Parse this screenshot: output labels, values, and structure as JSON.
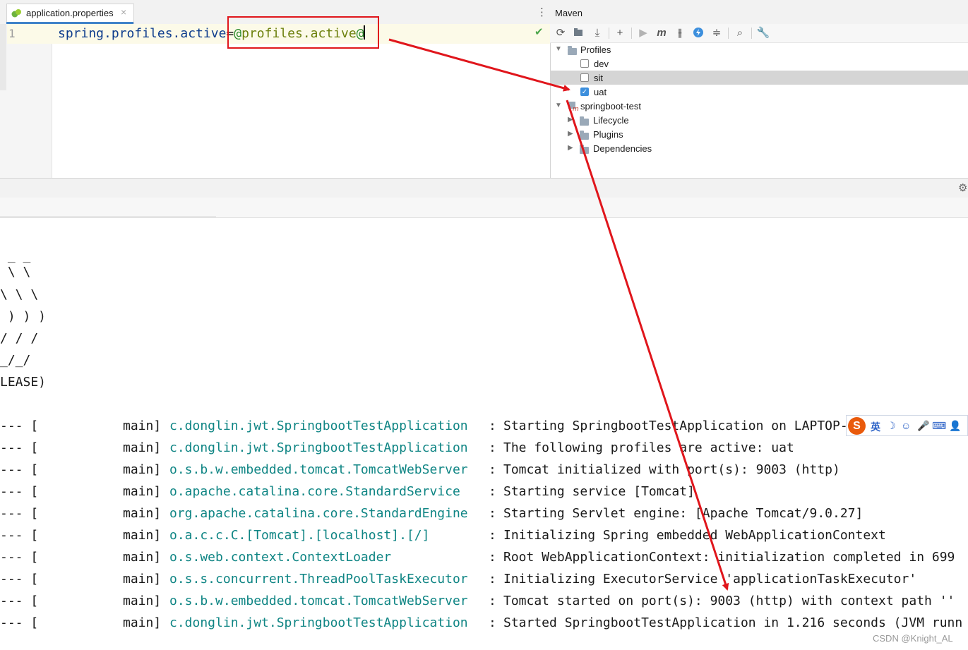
{
  "editor": {
    "tab_label": "application.properties",
    "tab_close": "×",
    "more_icon": "⋮",
    "line_number": "1",
    "code": {
      "key": "spring.profiles.active",
      "equals": "=",
      "at_open": "@",
      "value": "profiles.active",
      "at_close": "@"
    },
    "inspection_icon": "✔"
  },
  "maven": {
    "title": "Maven",
    "toolbar": [
      "reload-icon",
      "reimport-folder-icon",
      "download-icon",
      "add-icon",
      "run-icon",
      "maven-goal-icon",
      "toggle-offline-icon",
      "lightning-icon",
      "collapse-icon",
      "show-dependencies-icon",
      "settings-wrench-icon"
    ],
    "profiles_label": "Profiles",
    "profiles": [
      {
        "name": "dev",
        "checked": false
      },
      {
        "name": "sit",
        "checked": false
      },
      {
        "name": "uat",
        "checked": true
      }
    ],
    "project": "springboot-test",
    "children": [
      "Lifecycle",
      "Plugins",
      "Dependencies"
    ]
  },
  "console": {
    "banner": [
      " _ _",
      " \\ \\",
      "\\ \\ \\",
      " ) ) )",
      "/ / /",
      "_/_/",
      "LEASE)"
    ],
    "logs": [
      {
        "sep": "--- [",
        "thread": "main]",
        "logger": "c.donglin.jwt.SpringbootTestApplication",
        "msg": "Starting SpringbootTestApplication on LAPTOP-"
      },
      {
        "sep": "--- [",
        "thread": "main]",
        "logger": "c.donglin.jwt.SpringbootTestApplication",
        "msg": "The following profiles are active: uat"
      },
      {
        "sep": "--- [",
        "thread": "main]",
        "logger": "o.s.b.w.embedded.tomcat.TomcatWebServer",
        "msg": "Tomcat initialized with port(s): 9003 (http)"
      },
      {
        "sep": "--- [",
        "thread": "main]",
        "logger": "o.apache.catalina.core.StandardService",
        "msg": "Starting service [Tomcat]"
      },
      {
        "sep": "--- [",
        "thread": "main]",
        "logger": "org.apache.catalina.core.StandardEngine",
        "msg": "Starting Servlet engine: [Apache Tomcat/9.0.27]"
      },
      {
        "sep": "--- [",
        "thread": "main]",
        "logger": "o.a.c.c.C.[Tomcat].[localhost].[/]",
        "msg": "Initializing Spring embedded WebApplicationContext"
      },
      {
        "sep": "--- [",
        "thread": "main]",
        "logger": "o.s.web.context.ContextLoader",
        "msg": "Root WebApplicationContext: initialization completed in 699"
      },
      {
        "sep": "--- [",
        "thread": "main]",
        "logger": "o.s.s.concurrent.ThreadPoolTaskExecutor",
        "msg": "Initializing ExecutorService 'applicationTaskExecutor'"
      },
      {
        "sep": "--- [",
        "thread": "main]",
        "logger": "o.s.b.w.embedded.tomcat.TomcatWebServer",
        "msg": "Tomcat started on port(s): 9003 (http) with context path ''"
      },
      {
        "sep": "--- [",
        "thread": "main]",
        "logger": "c.donglin.jwt.SpringbootTestApplication",
        "msg": "Started SpringbootTestApplication in 1.216 seconds (JVM runn"
      }
    ],
    "colon": ":"
  },
  "ime": {
    "logo": "S",
    "lang": "英",
    "items": [
      "moon-icon",
      "emoji-icon",
      "mic-icon",
      "keyboard-icon",
      "user-icon"
    ]
  },
  "watermark": "CSDN @Knight_AL",
  "colors": {
    "accent": "#4083c9",
    "annotation_red": "#e0161c",
    "logger": "#0f8584",
    "checkbox": "#3c8fdd"
  }
}
